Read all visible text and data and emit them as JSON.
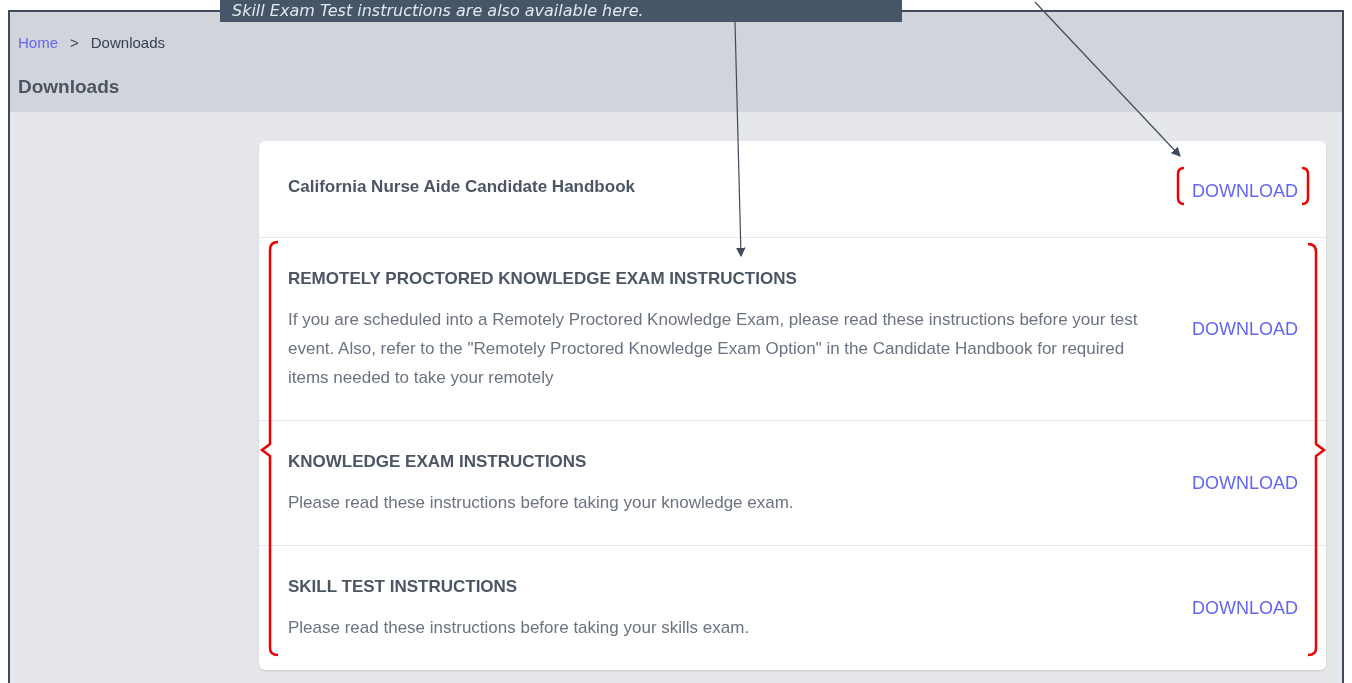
{
  "callout": {
    "text": "Skill Exam Test instructions are also available here."
  },
  "breadcrumb": {
    "items": [
      "Home",
      "Downloads"
    ],
    "separator": ">"
  },
  "page_title": "Downloads",
  "downloads": [
    {
      "title": "California Nurse Aide Candidate Handbook",
      "kind": "handbook",
      "action": "DOWNLOAD"
    },
    {
      "title": "REMOTELY PROCTORED KNOWLEDGE EXAM INSTRUCTIONS",
      "kind": "instructions",
      "description": "If you are scheduled into a Remotely Proctored Knowledge Exam, please read these instructions before your test event. Also, refer to the \"Remotely Proctored Knowledge Exam Option\" in the Candidate Handbook for required items needed to take your remotely",
      "action": "DOWNLOAD"
    },
    {
      "title": "KNOWLEDGE EXAM INSTRUCTIONS",
      "kind": "instructions",
      "description": "Please read these instructions before taking your knowledge exam.",
      "action": "DOWNLOAD"
    },
    {
      "title": "SKILL TEST INSTRUCTIONS",
      "kind": "instructions",
      "description": "Please read these instructions before taking your skills exam.",
      "action": "DOWNLOAD"
    }
  ]
}
